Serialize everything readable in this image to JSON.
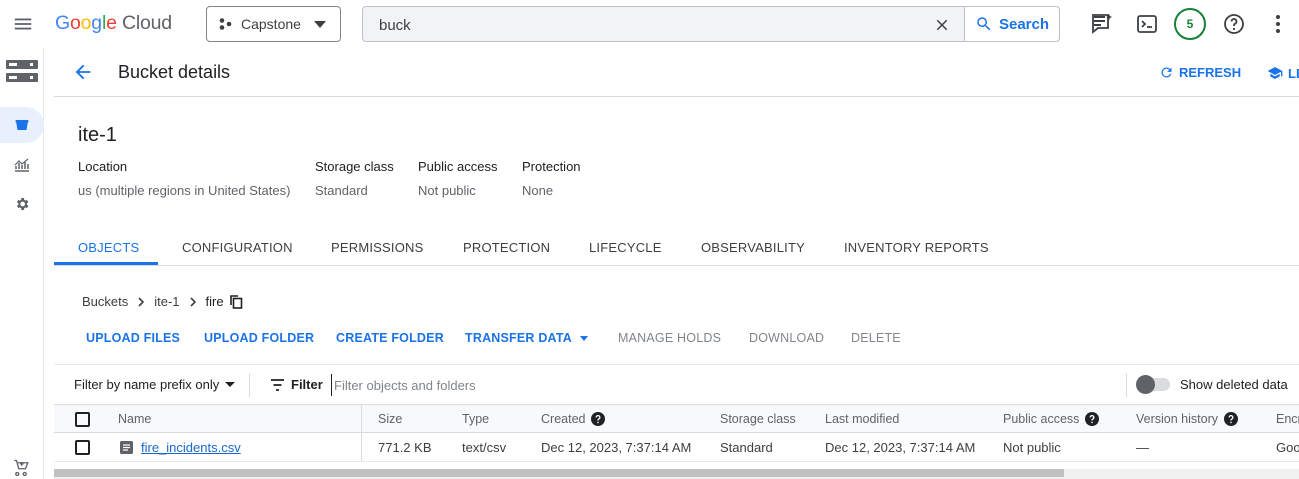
{
  "topbar": {
    "logo": {
      "g1": "G",
      "g2": "o",
      "g3": "o",
      "g4": "g",
      "g5": "l",
      "g6": "e",
      "cloud": "Cloud"
    },
    "project": "Capstone",
    "search": {
      "value": "buck",
      "button": "Search"
    },
    "avatar": "5",
    "icons": [
      "menu-icon",
      "project-icon",
      "clear-icon",
      "search-icon",
      "notifications-icon",
      "cloud-shell-icon",
      "help-icon",
      "more-vert-icon"
    ]
  },
  "leftnav": {
    "icons": [
      "storage-product-icon",
      "bucket-icon",
      "monitoring-icon",
      "settings-icon",
      "marketplace-cart-icon"
    ]
  },
  "header": {
    "title": "Bucket details",
    "refresh": "REFRESH",
    "learn": "LE"
  },
  "bucket": {
    "name": "ite-1",
    "meta": [
      {
        "label": "Location",
        "value": "us (multiple regions in United States)"
      },
      {
        "label": "Storage class",
        "value": "Standard"
      },
      {
        "label": "Public access",
        "value": "Not public"
      },
      {
        "label": "Protection",
        "value": "None"
      }
    ]
  },
  "tabs": [
    "OBJECTS",
    "CONFIGURATION",
    "PERMISSIONS",
    "PROTECTION",
    "LIFECYCLE",
    "OBSERVABILITY",
    "INVENTORY REPORTS"
  ],
  "breadcrumb": {
    "root": "Buckets",
    "bucket": "ite-1",
    "folder": "fire"
  },
  "actions": {
    "upload_files": "UPLOAD FILES",
    "upload_folder": "UPLOAD FOLDER",
    "create_folder": "CREATE FOLDER",
    "transfer_data": "TRANSFER DATA",
    "manage_holds": "MANAGE HOLDS",
    "download": "DOWNLOAD",
    "delete": "DELETE"
  },
  "filter": {
    "prefix": "Filter by name prefix only",
    "label": "Filter",
    "placeholder": "Filter objects and folders",
    "show_deleted": "Show deleted data"
  },
  "table": {
    "columns": [
      "Name",
      "Size",
      "Type",
      "Created",
      "Storage class",
      "Last modified",
      "Public access",
      "Version history",
      "Encr"
    ],
    "rows": [
      {
        "name": "fire_incidents.csv",
        "size": "771.2 KB",
        "type": "text/csv",
        "created": "Dec 12, 2023, 7:37:14 AM",
        "storage_class": "Standard",
        "last_modified": "Dec 12, 2023, 7:37:14 AM",
        "public_access": "Not public",
        "version_history": "—",
        "encryption": "Goo"
      }
    ]
  },
  "colors": {
    "accent": "#1a73e8",
    "avatar_ring": "#188038"
  }
}
